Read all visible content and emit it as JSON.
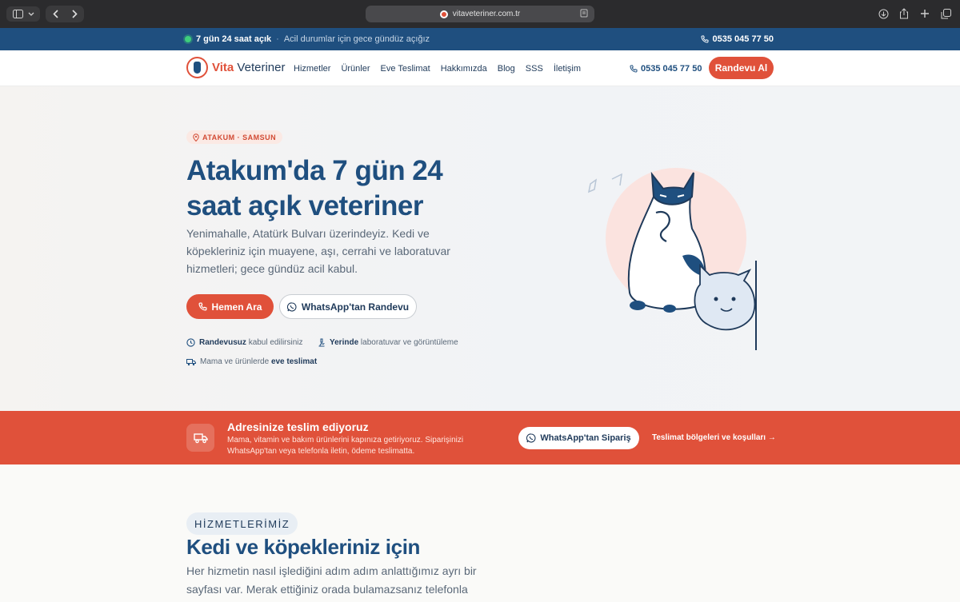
{
  "browser": {
    "url": "vitaveteriner.com.tr"
  },
  "topbar": {
    "open_label": "7 gün 24 saat açık",
    "separator": "·",
    "emergency_text": "Acil durumlar için gece gündüz açığız",
    "phone": "0535 045 77 50"
  },
  "nav": {
    "logo_bold": "Vita",
    "logo_rest": "Veteriner",
    "items": [
      {
        "label": "Hizmetler"
      },
      {
        "label": "Ürünler"
      },
      {
        "label": "Eve Teslimat"
      },
      {
        "label": "Hakkımızda"
      },
      {
        "label": "Blog"
      },
      {
        "label": "SSS"
      },
      {
        "label": "İletişim"
      }
    ],
    "phone": "0535 045 77 50",
    "cta": "Randevu Al"
  },
  "hero": {
    "location_chip": "ATAKUM · SAMSUN",
    "title": "Atakum'da 7 gün 24 saat açık veteriner",
    "description": "Yenimahalle, Atatürk Bulvarı üzerindeyiz. Kedi ve köpekleriniz için muayene, aşı, cerrahi ve laboratuvar hizmetleri; gece gündüz acil kabul.",
    "call_button": "Hemen Ara",
    "whatsapp_button": "WhatsApp'tan Randevu",
    "features": [
      {
        "bold": "Randevusuz",
        "rest": "kabul edilirsiniz"
      },
      {
        "bold": "Yerinde",
        "rest": "laboratuvar ve görüntüleme"
      },
      {
        "prefix": "Mama ve ürünlerde",
        "bold": "eve teslimat"
      }
    ]
  },
  "delivery": {
    "title": "Adresinize teslim ediyoruz",
    "description": "Mama, vitamin ve bakım ürünlerini kapınıza getiriyoruz. Siparişinizi WhatsApp'tan veya telefonla iletin, ödeme teslimatta.",
    "button": "WhatsApp'tan Sipariş",
    "link": "Teslimat bölgeleri ve koşulları →"
  },
  "services": {
    "chip": "HİZMETLERİMİZ",
    "title": "Kedi ve köpekleriniz için",
    "description": "Her hizmetin nasıl işlediğini adım adım anlattığımız ayrı bir sayfası var. Merak ettiğiniz orada bulamazsanız telefonla sorabilirsiniz."
  },
  "colors": {
    "brand_red": "#e0513a",
    "brand_blue": "#1f4f7f",
    "whatsapp_green": "#25d366"
  }
}
